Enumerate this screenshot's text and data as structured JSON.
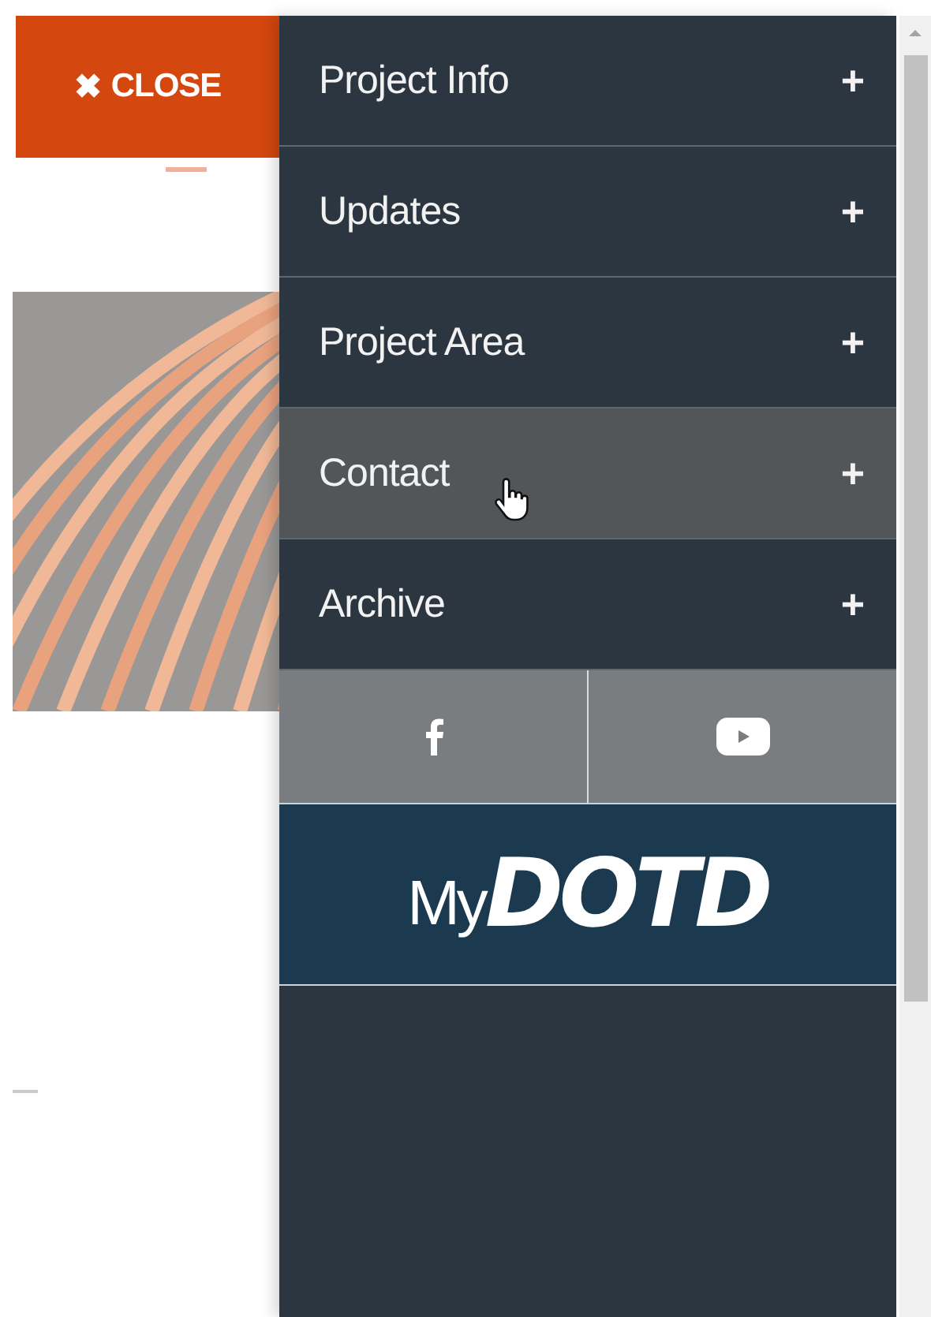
{
  "close_button": {
    "icon": "✖",
    "label": "CLOSE"
  },
  "menu": {
    "items": [
      {
        "label": "Project Info",
        "icon": "+",
        "hovered": false
      },
      {
        "label": "Updates",
        "icon": "+",
        "hovered": false
      },
      {
        "label": "Project Area",
        "icon": "+",
        "hovered": false
      },
      {
        "label": "Contact",
        "icon": "+",
        "hovered": true
      },
      {
        "label": "Archive",
        "icon": "+",
        "hovered": false
      }
    ]
  },
  "social": [
    {
      "kind": "facebook"
    },
    {
      "kind": "youtube"
    }
  ],
  "logo": {
    "prefix": "My",
    "name": "DOTD"
  }
}
